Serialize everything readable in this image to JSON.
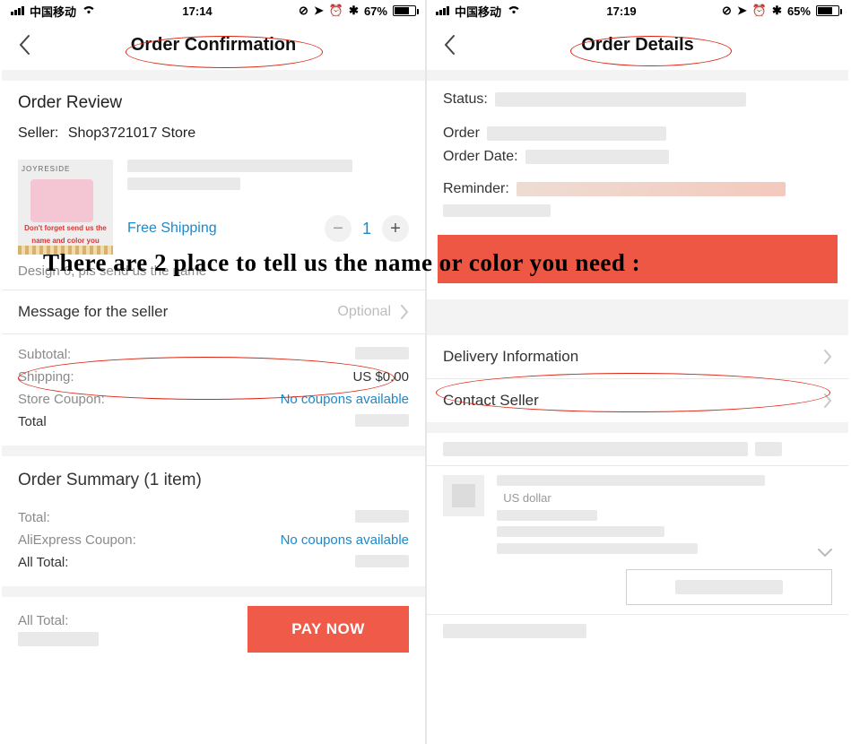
{
  "overlay_text": "There are 2 place to tell us the name or color you need :",
  "left": {
    "status": {
      "carrier": "中国移动",
      "time": "17:14",
      "battery_pct": "67%"
    },
    "header": {
      "title": "Order Confirmation"
    },
    "review_title": "Order Review",
    "seller_label": "Seller:",
    "seller_name": "Shop3721017 Store",
    "thumb": {
      "brand": "JOYRESIDE",
      "line1": "Don't forget send us the",
      "line2": "name and color you need!"
    },
    "free_shipping": "Free Shipping",
    "qty": "1",
    "variant_note": "Design 6, pls send us the name",
    "msg_label": "Message for the seller",
    "msg_hint": "Optional",
    "kv": {
      "subtotal_k": "Subtotal:",
      "shipping_k": "Shipping:",
      "shipping_v": "US $0.00",
      "coupon_k": "Store Coupon:",
      "coupon_v": "No coupons available",
      "total_k": "Total"
    },
    "summary_title": "Order Summary (1 item)",
    "sum": {
      "total_k": "Total:",
      "ali_coupon_k": "AliExpress Coupon:",
      "ali_coupon_v": "No coupons available",
      "all_total_k": "All Total:"
    },
    "footer": {
      "all_total_k": "All Total:",
      "pay_btn": "PAY NOW"
    }
  },
  "right": {
    "status": {
      "carrier": "中国移动",
      "time": "17:19",
      "battery_pct": "65%"
    },
    "header": {
      "title": "Order Details"
    },
    "fields": {
      "status_k": "Status:",
      "order_k": "Order",
      "order_date_k": "Order Date:",
      "reminder_k": "Reminder:"
    },
    "links": {
      "delivery": "Delivery Information",
      "contact": "Contact Seller"
    },
    "currency_hint": "US dollar"
  }
}
